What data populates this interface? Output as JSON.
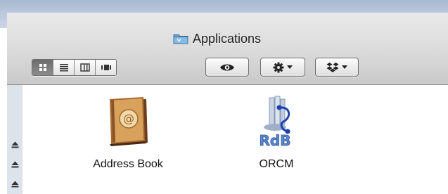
{
  "window": {
    "title": "Applications",
    "title_icon": "folder-icon"
  },
  "toolbar": {
    "view_modes": [
      {
        "icon": "icon-view-icon",
        "selected": true
      },
      {
        "icon": "list-view-icon",
        "selected": false
      },
      {
        "icon": "column-view-icon",
        "selected": false
      },
      {
        "icon": "cover-flow-view-icon",
        "selected": false
      }
    ],
    "quick_look_icon": "eye-icon",
    "action_icon": "gear-icon",
    "dropbox_icon": "dropbox-icon"
  },
  "sidebar": {
    "eject_icons": [
      "eject-icon",
      "eject-icon",
      "eject-icon"
    ]
  },
  "files": [
    {
      "label": "Address Book",
      "icon": "address-book-icon"
    },
    {
      "label": "ORCM",
      "icon": "rdb-app-icon"
    }
  ],
  "colors": {
    "toolbar_top": "#e9e9e9",
    "toolbar_bottom": "#c9c9c9",
    "sidebar": "#dde3ea",
    "selected_view_button": "#6c6c6c",
    "desktop": "#b4c2d9"
  }
}
